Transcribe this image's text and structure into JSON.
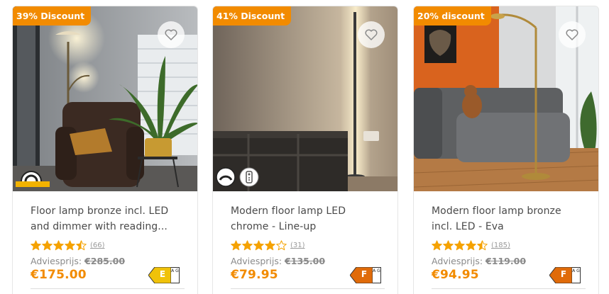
{
  "colors": {
    "accent": "#f28b00",
    "star": "#f5a200",
    "energy_E": "#f0c20a",
    "energy_F": "#e06b0a"
  },
  "products": [
    {
      "badge": "39% Discount",
      "title_line1": "Floor lamp bronze incl. LED",
      "title_line2": "and dimmer with reading...",
      "rating": 4.5,
      "review_count": "(66)",
      "advice_label": "Adviesprijs:",
      "old_price": "€285.00",
      "price": "€175.00",
      "energy_class": "E",
      "energy_scale": "A G",
      "feature_icons": [
        "dimmable-icon"
      ]
    },
    {
      "badge": "41% Discount",
      "title_line1": "Modern floor lamp LED",
      "title_line2": "chrome - Line-up",
      "rating": 4,
      "review_count": "(31)",
      "advice_label": "Adviesprijs:",
      "old_price": "€135.00",
      "price": "€79.95",
      "energy_class": "F",
      "energy_scale": "A G",
      "feature_icons": [
        "dimmable-icon",
        "remote-control-icon"
      ]
    },
    {
      "badge": "20% discount",
      "title_line1": "Modern floor lamp bronze",
      "title_line2": "incl. LED - Eva",
      "rating": 4.5,
      "review_count": "(185)",
      "advice_label": "Adviesprijs:",
      "old_price": "€119.00",
      "price": "€94.95",
      "energy_class": "F",
      "energy_scale": "A G",
      "feature_icons": []
    }
  ]
}
